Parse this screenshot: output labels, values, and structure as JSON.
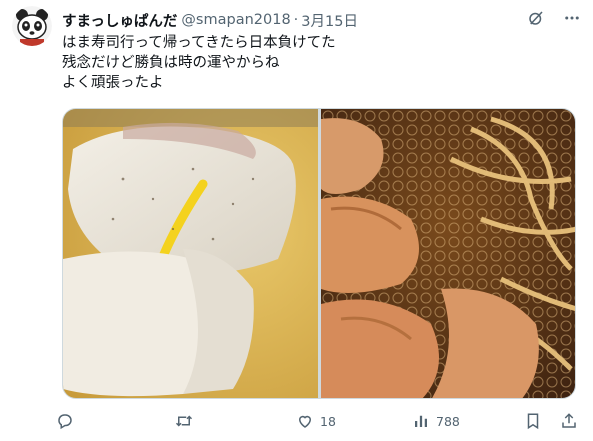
{
  "author": {
    "display_name": "すまっしゅぱんだ",
    "handle": "@smapan2018",
    "separator": "·",
    "date": "3月15日"
  },
  "tweet": {
    "lines": [
      "はま寿司行って帰ってきたら日本負けてた",
      "残念だけど勝負は時の運やからね",
      "よく頑張ったよ"
    ]
  },
  "media": {
    "photos": [
      "sushi-photo",
      "ramen-photo"
    ]
  },
  "actions": {
    "reply_count": "",
    "retweet_count": "",
    "like_count": "18",
    "view_count": "788"
  },
  "icons": [
    "grok-icon",
    "more-icon",
    "reply-icon",
    "retweet-icon",
    "like-icon",
    "views-icon",
    "bookmark-icon",
    "share-icon"
  ],
  "colors": {
    "text": "#0f1419",
    "secondary": "#536471",
    "border": "#cfd9de"
  }
}
